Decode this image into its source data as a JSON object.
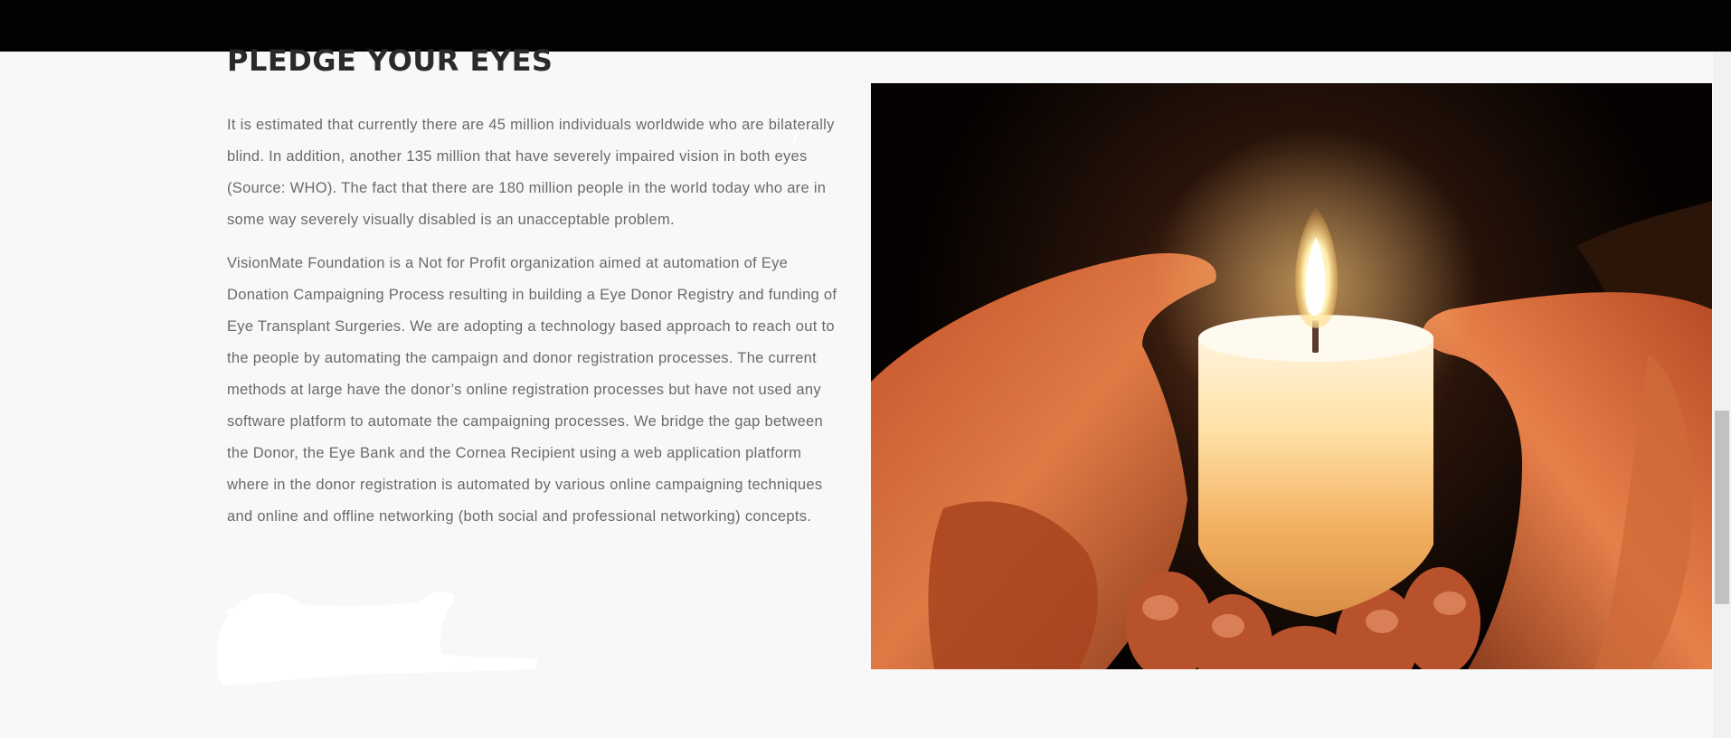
{
  "section": {
    "heading": "PLEDGE YOUR EYES",
    "paragraphs": [
      "It is estimated that currently there are 45 million individuals worldwide who are bilaterally blind. In addition, another 135 million that have severely impaired vision in both eyes (Source: WHO). The fact that there are 180 million people in the world today who are in some way severely visually disabled is an unacceptable problem.",
      "VisionMate Foundation is a Not for Profit organization aimed at automation of Eye Donation Campaigning Process resulting in building a Eye Donor Registry and funding of Eye Transplant Surgeries. We are adopting a technology based approach to reach out to the people by automating the campaign and donor registration processes. The current methods at large have the donor’s online registration processes but have not used any software platform to automate the campaigning processes. We bridge the gap between the Donor, the Eye Bank and the Cornea Recipient using a web application platform where in the donor registration is automated by various online campaigning techniques and online and offline networking (both social and professional networking) concepts."
    ],
    "image_icon": "candle-in-hands-photo",
    "signature_icon": "handwritten-signature"
  },
  "colors": {
    "top_bar": "#020202",
    "page_background": "#f8f8f8",
    "heading": "#2a2a2a",
    "body_text": "#6a6a6a",
    "scrollbar_thumb": "#c1c1c1"
  }
}
